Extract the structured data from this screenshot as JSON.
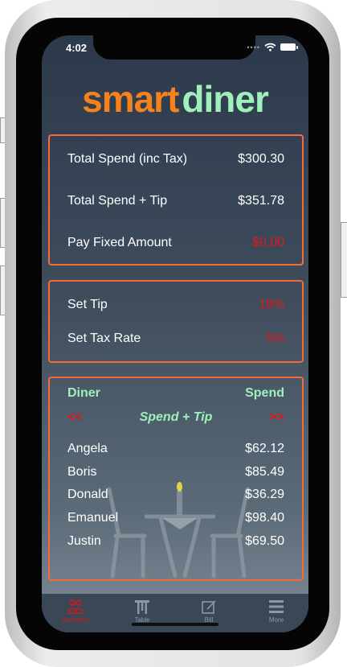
{
  "status_bar": {
    "time": "4:02"
  },
  "logo": {
    "part1": "smart",
    "part2": "diner"
  },
  "totals": [
    {
      "label": "Total Spend (inc Tax)",
      "value": "$300.30"
    },
    {
      "label": "Total Spend + Tip",
      "value": "$351.78"
    },
    {
      "label": "Pay Fixed Amount",
      "value": "$0.00"
    }
  ],
  "settings": [
    {
      "label": "Set Tip",
      "value": "18%"
    },
    {
      "label": "Set Tax Rate",
      "value": "5%"
    }
  ],
  "diner_table": {
    "header_left": "Diner",
    "header_right": "Spend",
    "prev": "<<",
    "mode": "Spend + Tip",
    "next": ">>",
    "rows": [
      {
        "name": "Angela",
        "amount": "$62.12"
      },
      {
        "name": "Boris",
        "amount": "$85.49"
      },
      {
        "name": "Donald",
        "amount": "$36.29"
      },
      {
        "name": "Emanuel",
        "amount": "$98.40"
      },
      {
        "name": "Justin",
        "amount": "$69.50"
      }
    ]
  },
  "tabs": [
    {
      "label": "Summary",
      "icon": "people-icon",
      "active": true
    },
    {
      "label": "Table",
      "icon": "table-icon",
      "active": false
    },
    {
      "label": "Bill",
      "icon": "edit-icon",
      "active": false
    },
    {
      "label": "More",
      "icon": "menu-icon",
      "active": false
    }
  ],
  "colors": {
    "accent_orange": "#f5811f",
    "accent_mint": "#9ff0bb",
    "border": "#f26b3a",
    "alert_red": "#e8141a",
    "active_tab": "#d11a1a"
  }
}
